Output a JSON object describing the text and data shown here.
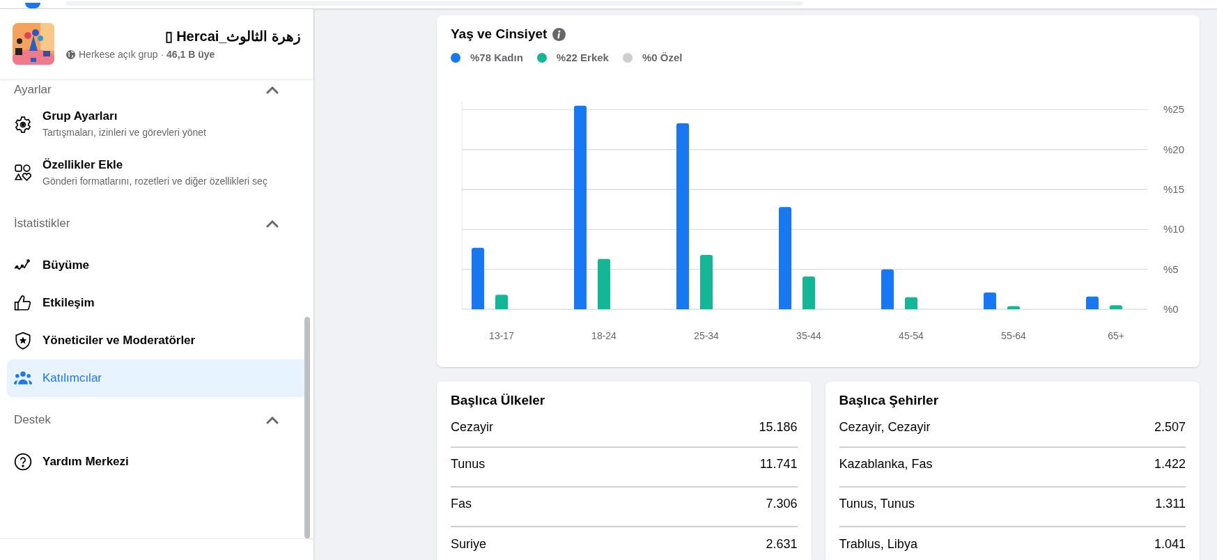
{
  "group": {
    "name": "زهرة الثالوث_Hercai ▯",
    "meta": "Herkese açık grup · **46,1 B üye**"
  },
  "sidebar": {
    "sections": [
      {
        "title": "Ayarlar",
        "expanded": true,
        "items": [
          {
            "label": "Grup Ayarları",
            "description": "Tartışmaları, izinleri ve görevleri yönet",
            "selected": false
          },
          {
            "label": "Özellikler Ekle",
            "description": "Gönderi formatlarını, rozetleri ve diğer özellikleri seç",
            "selected": false
          }
        ]
      },
      {
        "title": "İstatistikler",
        "expanded": true,
        "items": [
          {
            "label": "Büyüme",
            "selected": false
          },
          {
            "label": "Etkileşim",
            "selected": false
          },
          {
            "label": "Yöneticiler ve Moderatörler",
            "selected": false
          },
          {
            "label": "Katılımcılar",
            "selected": true
          }
        ]
      },
      {
        "title": "Destek",
        "expanded": true,
        "items": [
          {
            "label": "Yardım Merkezi",
            "selected": false
          }
        ]
      }
    ]
  },
  "age_gender": {
    "title": "Yaş ve Cinsiyet",
    "legend": [
      {
        "label": "%78 Kadın",
        "color": "#1877f2"
      },
      {
        "label": "%22 Erkek",
        "color": "#13b795"
      },
      {
        "label": "%0 Özel",
        "color": "#cbced3"
      }
    ],
    "chart_data": {
      "type": "bar",
      "categories": [
        "13-17",
        "18-24",
        "25-34",
        "35-44",
        "45-54",
        "55-64",
        "65+"
      ],
      "series": [
        {
          "color": "#1877f2",
          "values": [
            7.7,
            25.5,
            23.3,
            12.8,
            5.0,
            2.1,
            1.6
          ]
        },
        {
          "color": "#13b795",
          "values": [
            1.8,
            6.3,
            6.8,
            4.1,
            1.5,
            0.4,
            0.5
          ]
        }
      ],
      "ylim": [
        0,
        26
      ],
      "grid": true,
      "yticks": [
        {
          "value": 0,
          "label": "%0"
        },
        {
          "value": 5,
          "label": "%5"
        },
        {
          "value": 10,
          "label": "%10"
        },
        {
          "value": 15,
          "label": "%15"
        },
        {
          "value": 20,
          "label": "%20"
        },
        {
          "value": 25,
          "label": "%25"
        }
      ]
    }
  },
  "top_lists": [
    {
      "title": "Başlıca Ülkeler",
      "rows": [
        {
          "name": "Cezayir",
          "count": "15.186"
        },
        {
          "name": "Tunus",
          "count": "11.741"
        },
        {
          "name": "Fas",
          "count": "7.306"
        },
        {
          "name": "Suriye",
          "count": "2.631"
        }
      ]
    },
    {
      "title": "Başlıca Şehirler",
      "rows": [
        {
          "name": "Cezayir, Cezayir",
          "count": "2.507"
        },
        {
          "name": "Kazablanka, Fas",
          "count": "1.422"
        },
        {
          "name": "Tunus, Tunus",
          "count": "1.311"
        },
        {
          "name": "Trablus, Libya",
          "count": "1.041"
        }
      ]
    }
  ]
}
